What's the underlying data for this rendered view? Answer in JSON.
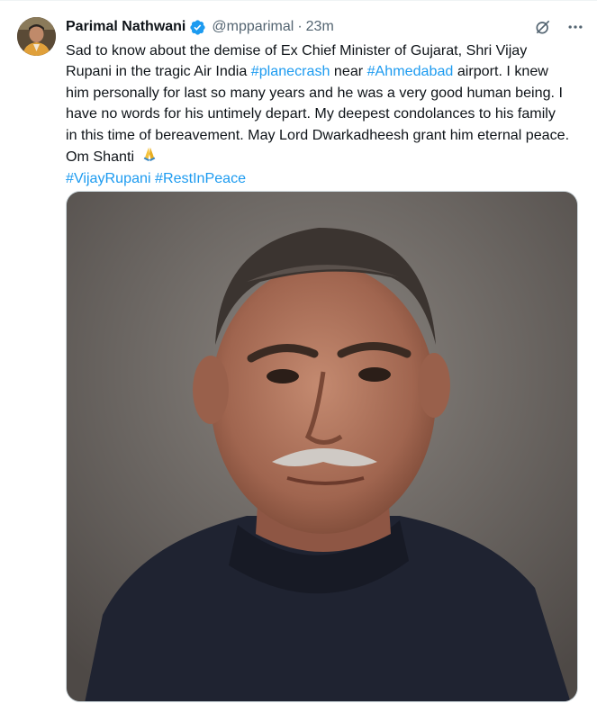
{
  "tweet": {
    "author": {
      "display_name": "Parimal Nathwani",
      "handle": "@mpparimal",
      "verified": true,
      "verified_color": "#1d9bf0"
    },
    "separator": "·",
    "timestamp": "23m",
    "text_lines": [
      {
        "parts": [
          {
            "text": "Sad to know about the demise of Ex Chief Minister of Gujarat, Shri Vijay",
            "tag": false
          }
        ]
      },
      {
        "parts": [
          {
            "text": "Rupani in the tragic Air India ",
            "tag": false
          },
          {
            "text": "#planecrash",
            "tag": true
          },
          {
            "text": " near ",
            "tag": false
          },
          {
            "text": "#Ahmedabad",
            "tag": true
          },
          {
            "text": " airport. I knew",
            "tag": false
          }
        ]
      },
      {
        "parts": [
          {
            "text": "him personally for last so many years and he was a very good human being. I",
            "tag": false
          }
        ]
      },
      {
        "parts": [
          {
            "text": "have no words for his untimely depart. My deepest condolances to his family",
            "tag": false
          }
        ]
      },
      {
        "parts": [
          {
            "text": "in this time of bereavement. May Lord Dwarkadheesh grant him eternal peace.",
            "tag": false
          }
        ]
      },
      {
        "parts": [
          {
            "text": "Om Shanti ",
            "tag": false
          }
        ],
        "emoji": "folded-hands-emoji"
      },
      {
        "parts": [
          {
            "text": "#VijayRupani",
            "tag": true
          },
          {
            "text": " ",
            "tag": false
          },
          {
            "text": "#RestInPeace",
            "tag": true
          }
        ]
      }
    ],
    "media": {
      "icon": "portrait-photo",
      "description_colors": {
        "background": "#6e6864",
        "suit": "#1f2331",
        "skin": "#a9705a",
        "hair": "#3b3430"
      }
    },
    "actions": {
      "grok_icon": "grok-icon",
      "more_icon": "more-icon"
    },
    "colors": {
      "text": "#0f1419",
      "muted": "#536471",
      "link": "#1d9bf0"
    }
  }
}
